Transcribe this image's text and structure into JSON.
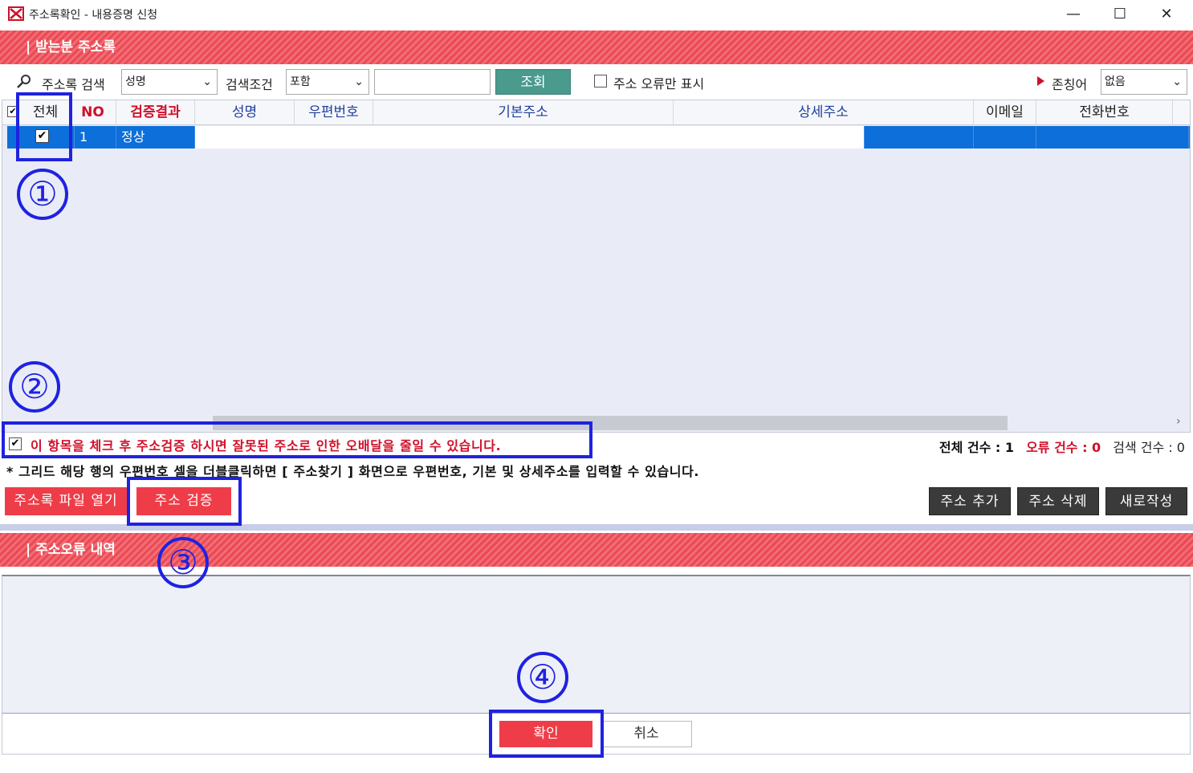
{
  "window": {
    "title": "주소록확인 - 내용증명 신청",
    "minimize": "—",
    "maximize": "☐",
    "close": "✕"
  },
  "recipients_section": {
    "header": "| 받는분 주소록"
  },
  "search": {
    "label": "주소록 검색",
    "field_select": "성명",
    "condition_label": "검색조건",
    "condition_select": "포함",
    "query_value": "",
    "query_button": "조회",
    "error_only_label": "주소 오류만 표시",
    "title_label": "존칭어",
    "title_select": "없음"
  },
  "grid": {
    "columns": [
      "전체",
      "NO",
      "검증결과",
      "성명",
      "우편번호",
      "기본주소",
      "상세주소",
      "이메일",
      "전화번호"
    ],
    "rows": [
      {
        "checked": "✔",
        "no": "1",
        "result": "정상",
        "name": "",
        "zip": "",
        "address": "",
        "detail": "",
        "email": "",
        "phone": ""
      }
    ],
    "scroll_arrow": "›"
  },
  "notes": {
    "verify_check": "✔",
    "verify_note": "이 항목을 체크 후 주소검증 하시면 잘못된 주소로 인한 오배달을 줄일 수 있습니다.",
    "grid_hint": "* 그리드 해당 행의 우편번호 셀을 더블클릭하면 [ 주소찾기 ] 화면으로 우편번호, 기본 및 상세주소를 입력할 수 있습니다."
  },
  "counts": {
    "total": "전체 건수 : 1",
    "errors": "오류 건수 : 0",
    "search": "검색 건수 : 0"
  },
  "actions": {
    "open_file": "주소록 파일 열기",
    "verify": "주소 검증",
    "add": "주소 추가",
    "delete": "주소 삭제",
    "new": "새로작성"
  },
  "error_section": {
    "header": "| 주소오류 내역"
  },
  "footer": {
    "ok": "확인",
    "cancel": "취소"
  },
  "annotations": [
    "①",
    "②",
    "③",
    "④"
  ],
  "colors": {
    "header_red": "#ea4a54",
    "button_red": "#ee3d48",
    "selected_row": "#0d6fd9",
    "annotation_blue": "#1f22e0",
    "query_teal": "#4a9a8e"
  }
}
